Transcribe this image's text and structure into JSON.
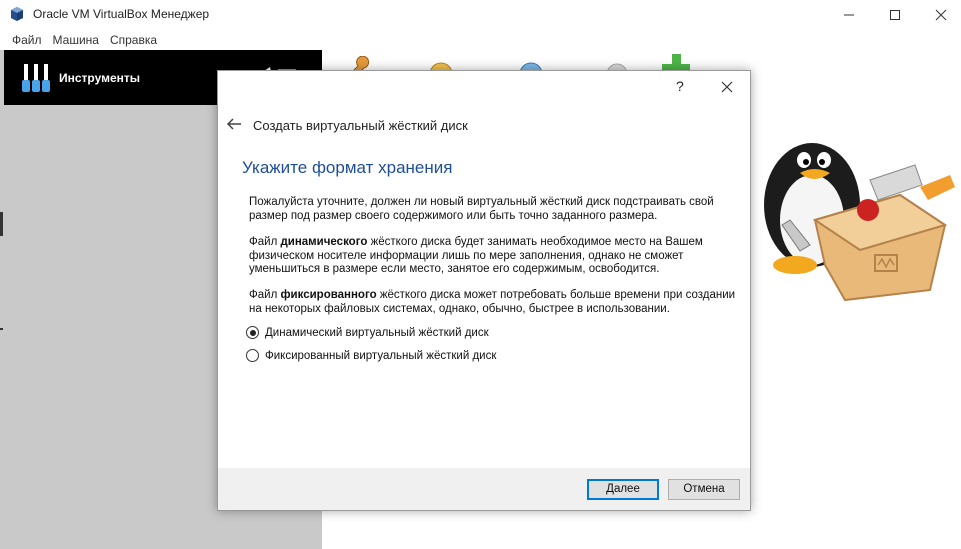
{
  "window": {
    "title": "Oracle VM VirtualBox Менеджер",
    "controls": {
      "minimize": "minimize",
      "maximize": "maximize",
      "close": "close"
    }
  },
  "menu": [
    "Файл",
    "Машина",
    "Справка"
  ],
  "sidebar": {
    "tools_label": "Инструменты"
  },
  "dialog": {
    "help_label": "?",
    "title": "Создать виртуальный жёсткий диск",
    "heading": "Укажите формат хранения",
    "p1": "Пожалуйста уточните, должен ли новый виртуальный жёсткий диск подстраивать свой размер под размер своего содержимого или быть точно заданного размера.",
    "p2_a": "Файл ",
    "p2_b": "динамического",
    "p2_c": " жёсткого диска будет занимать необходимое место на Вашем физическом носителе информации лишь по мере заполнения, однако не сможет уменьшиться в размере если место, занятое его содержимым, освободится.",
    "p3_a": "Файл ",
    "p3_b": "фиксированного",
    "p3_c": " жёсткого диска может потребовать больше времени при создании на некоторых файловых системах, однако, обычно, быстрее в использовании.",
    "options": [
      {
        "label": "Динамический виртуальный жёсткий диск",
        "selected": true
      },
      {
        "label": "Фиксированный виртуальный жёсткий диск",
        "selected": false
      }
    ],
    "buttons": {
      "next": "Далее",
      "cancel": "Отмена"
    }
  },
  "colors": {
    "heading": "#1f4e99",
    "accent": "#0078d7",
    "sidebar_bg": "#c9c9c9",
    "tools_bg": "#000000"
  }
}
